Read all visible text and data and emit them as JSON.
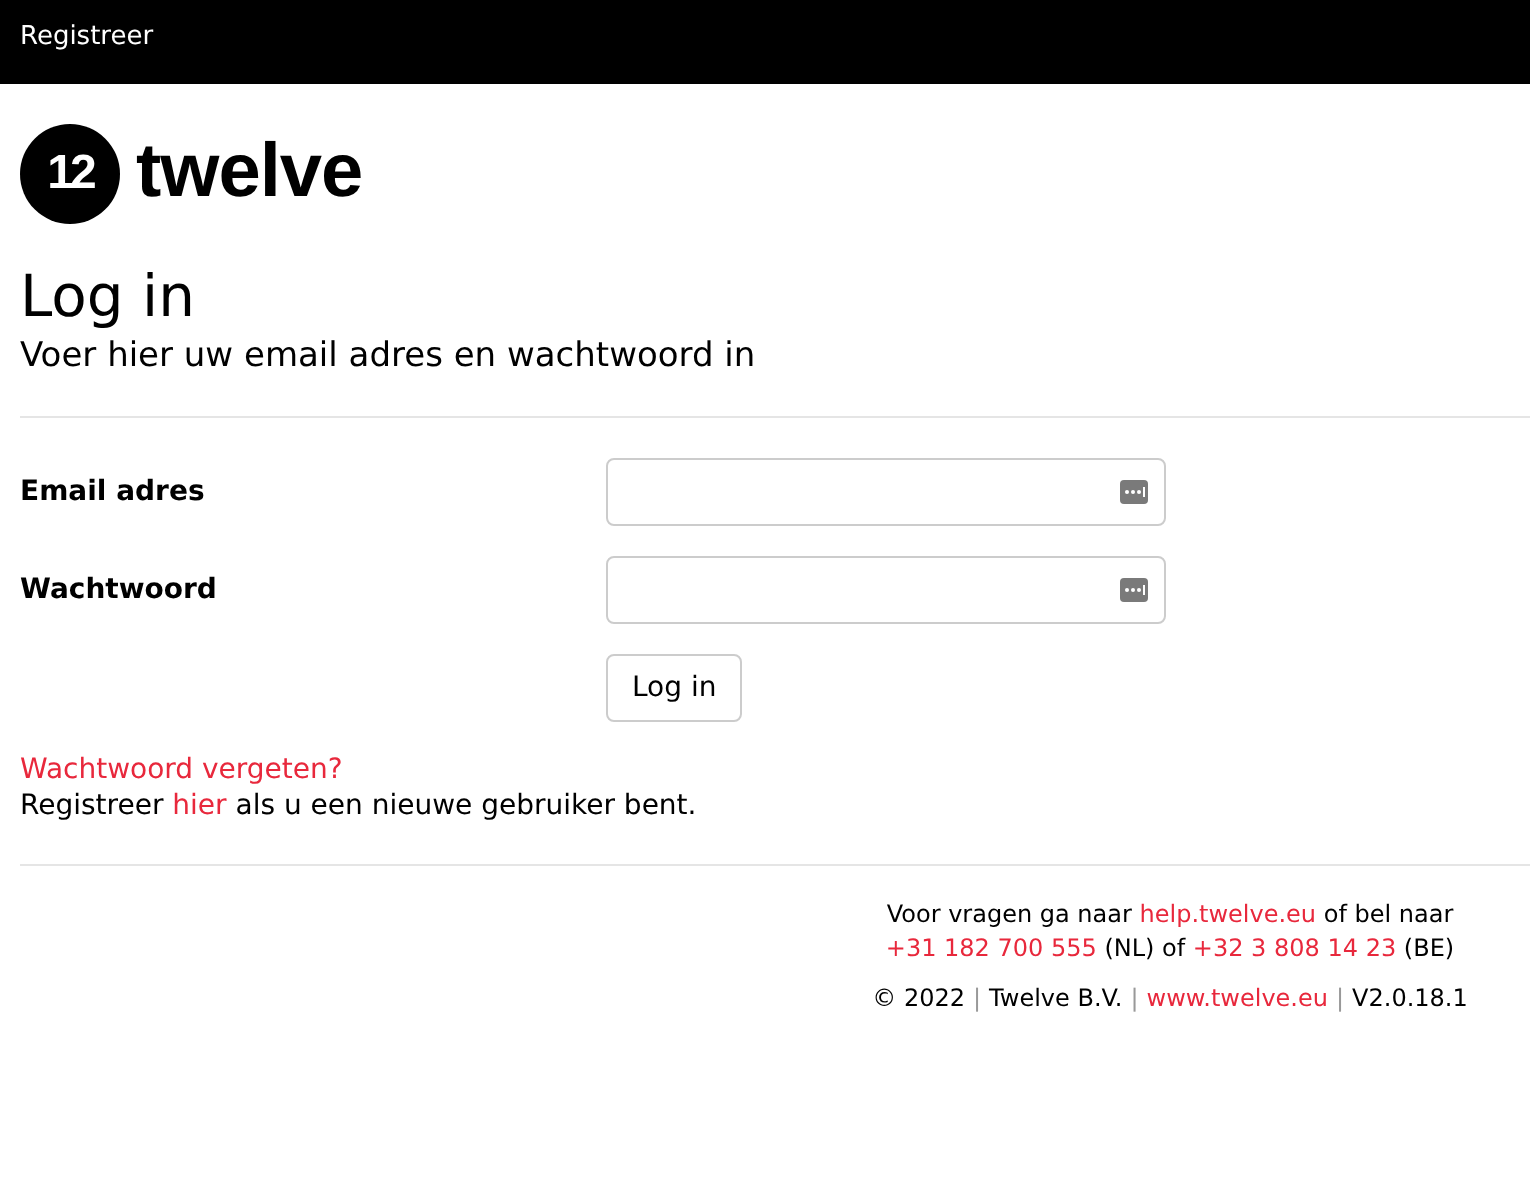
{
  "header": {
    "link": "Registreer"
  },
  "logo": {
    "mark": "12",
    "name": "twelve"
  },
  "title": "Log in",
  "subtitle": "Voer hier uw email adres en wachtwoord in",
  "fields": [
    {
      "label": "Email adres"
    },
    {
      "label": "Wachtwoord"
    }
  ],
  "submit": "Log in",
  "forgot_link": "Wachtwoord vergeten?",
  "register_line": [
    {
      "text": "Registreer ",
      "kind": "text"
    },
    {
      "text": "hier",
      "kind": "link"
    },
    {
      "text": " als u een nieuwe gebruiker bent.",
      "kind": "text"
    }
  ],
  "footer": {
    "lines": [
      [
        {
          "text": "Voor vragen ga naar ",
          "kind": "text"
        },
        {
          "text": "help.twelve.eu",
          "kind": "link"
        },
        {
          "text": " of bel naar",
          "kind": "text"
        }
      ],
      [
        {
          "text": "+31 182 700 555",
          "kind": "link"
        },
        {
          "text": " (NL) of ",
          "kind": "text"
        },
        {
          "text": "+32 3 808 14 23",
          "kind": "link"
        },
        {
          "text": " (BE)",
          "kind": "text"
        }
      ],
      [
        {
          "text": "© 2022",
          "kind": "text"
        },
        {
          "text": "|",
          "kind": "separator"
        },
        {
          "text": "Twelve B.V.",
          "kind": "text"
        },
        {
          "text": "|",
          "kind": "separator"
        },
        {
          "text": "www.twelve.eu",
          "kind": "link"
        },
        {
          "text": "|",
          "kind": "separator"
        },
        {
          "text": "V2.0.18.1",
          "kind": "text"
        }
      ]
    ]
  }
}
